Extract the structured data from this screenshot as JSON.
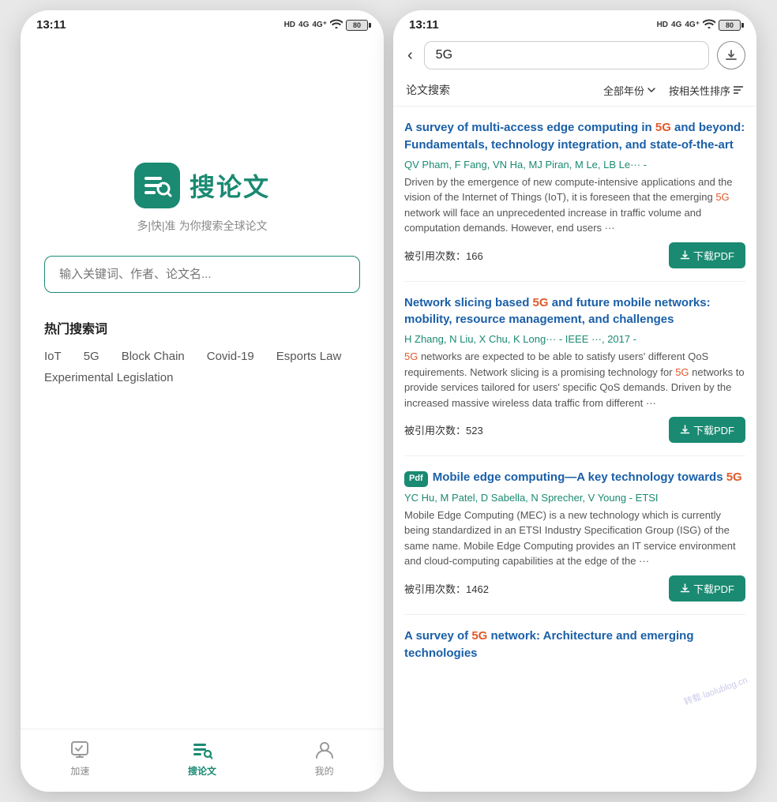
{
  "left_phone": {
    "status": {
      "time": "13:11",
      "icons": [
        "HD",
        "4G",
        "4G+",
        "wifi",
        "80"
      ]
    },
    "logo": {
      "text": "搜论文",
      "subtitle": "多|快|准 为你搜索全球论文"
    },
    "search": {
      "placeholder": "输入关键词、作者、论文名..."
    },
    "hot_section": {
      "title": "热门搜索词",
      "tags": [
        "IoT",
        "5G",
        "Block Chain",
        "Covid-19",
        "Esports Law",
        "Experimental Legislation"
      ]
    },
    "bottom_nav": [
      {
        "label": "加速",
        "key": "speedup"
      },
      {
        "label": "搜论文",
        "key": "search",
        "active": true
      },
      {
        "label": "我的",
        "key": "mine"
      }
    ]
  },
  "right_phone": {
    "status": {
      "time": "13:11",
      "icons": [
        "HD",
        "4G",
        "4G+",
        "wifi",
        "80"
      ]
    },
    "search_query": "5G",
    "filter": {
      "label": "论文搜索",
      "year": "全部年份",
      "sort": "按相关性排序"
    },
    "results": [
      {
        "title_parts": [
          "A survey of multi-access edge computing in ",
          "5G",
          " and beyond: Fundamentals, technology integration, and state-of-the-art"
        ],
        "authors": "QV Pham, F Fang, VN Ha, MJ Piran, M Le, LB Le··· -",
        "abstract": "Driven by the emergence of new compute-intensive applications and the vision of the Internet of Things (IoT), it is foreseen that the emerging 5G network will face an unprecedented increase in traffic volume and computation demands. However, end users ···",
        "abstract_highlights": [
          "5G"
        ],
        "cite_count": "被引用次数：166",
        "has_pdf": false
      },
      {
        "title_parts": [
          "Network slicing based ",
          "5G",
          " and future mobile networks: mobility, resource management, and challenges"
        ],
        "authors": "H Zhang, N Liu, X Chu, K Long··· - IEEE ···, 2017 -",
        "abstract": "5G networks are expected to be able to satisfy users' different QoS requirements. Network slicing is a promising technology for 5G networks to provide services tailored for users' specific QoS demands. Driven by the increased massive wireless data traffic from different ···",
        "abstract_highlights": [
          "5G",
          "5G",
          "5G"
        ],
        "cite_count": "被引用次数：523",
        "has_pdf": false
      },
      {
        "title_parts": [
          "Mobile edge computing—A key technology towards ",
          "5G"
        ],
        "authors": "YC Hu, M Patel, D Sabella, N Sprecher, V Young - ETSI",
        "abstract": "Mobile Edge Computing (MEC) is a new technology which is currently being standardized in an ETSI Industry Specification Group (ISG) of the same name. Mobile Edge Computing provides an IT service environment and cloud-computing capabilities at the edge of the ···",
        "abstract_highlights": [],
        "cite_count": "被引用次数：1462",
        "has_pdf": true
      },
      {
        "title_parts": [
          "A survey of ",
          "5G",
          " network: Architecture and emerging technologies"
        ],
        "partial": true
      }
    ],
    "watermark": "转载·laolublog.cn"
  }
}
